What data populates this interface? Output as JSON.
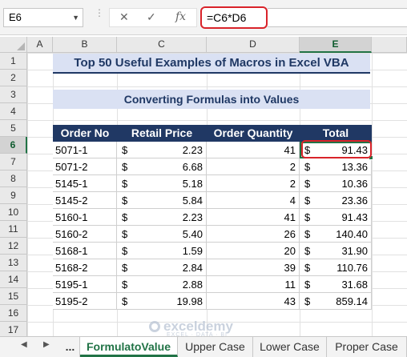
{
  "name_box": "E6",
  "formula_buttons": {
    "cancel": "✕",
    "enter": "✓",
    "fx": "fx"
  },
  "formula": "=C6*D6",
  "columns": [
    "A",
    "B",
    "C",
    "D",
    "E"
  ],
  "rows": [
    "1",
    "2",
    "3",
    "4",
    "5",
    "6",
    "7",
    "8",
    "9",
    "10",
    "11",
    "12",
    "13",
    "14",
    "15",
    "16",
    "17"
  ],
  "title": "Top 50 Useful Examples of Macros in Excel VBA",
  "subtitle": "Converting Formulas into Values",
  "table": {
    "headers": [
      "Order No",
      "Retail Price",
      "Order Quantity",
      "Total"
    ],
    "currency": "$",
    "rows": [
      {
        "order": "5071-1",
        "price": "2.23",
        "qty": "41",
        "total": "91.43"
      },
      {
        "order": "5071-2",
        "price": "6.68",
        "qty": "2",
        "total": "13.36"
      },
      {
        "order": "5145-1",
        "price": "5.18",
        "qty": "2",
        "total": "10.36"
      },
      {
        "order": "5145-2",
        "price": "5.84",
        "qty": "4",
        "total": "23.36"
      },
      {
        "order": "5160-1",
        "price": "2.23",
        "qty": "41",
        "total": "91.43"
      },
      {
        "order": "5160-2",
        "price": "5.40",
        "qty": "26",
        "total": "140.40"
      },
      {
        "order": "5168-1",
        "price": "1.59",
        "qty": "20",
        "total": "31.90"
      },
      {
        "order": "5168-2",
        "price": "2.84",
        "qty": "39",
        "total": "110.76"
      },
      {
        "order": "5195-1",
        "price": "2.88",
        "qty": "11",
        "total": "31.68"
      },
      {
        "order": "5195-2",
        "price": "19.98",
        "qty": "43",
        "total": "859.14"
      }
    ]
  },
  "sheet_tabs": {
    "nav_prev": "◀",
    "nav_next": "▶",
    "more": "...",
    "tabs": [
      "FormulatoValue",
      "Upper Case",
      "Lower Case",
      "Proper Case"
    ],
    "active": "FormulatoValue"
  },
  "watermark": {
    "name": "exceldemy",
    "tagline": "EXCEL · DATA · BI"
  },
  "colors": {
    "accent": "#217346",
    "header_bg": "#203864",
    "title_bg": "#dae1f3",
    "highlight": "#d9232a"
  }
}
